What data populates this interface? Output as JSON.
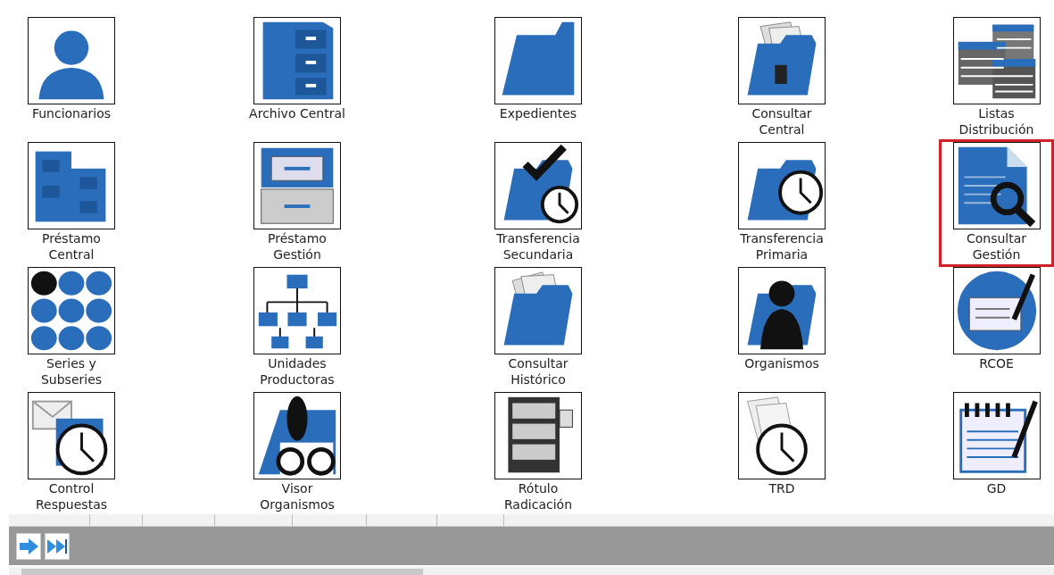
{
  "modules": [
    {
      "label": "Funcionarios",
      "kind": "person",
      "selected": false
    },
    {
      "label": "Archivo Central",
      "kind": "cabinet",
      "selected": false
    },
    {
      "label": "Expedientes",
      "kind": "folder",
      "selected": false
    },
    {
      "label": "Consultar Central",
      "kind": "folder-docs",
      "selected": false
    },
    {
      "label": "Listas Distribución",
      "kind": "lists",
      "selected": false
    },
    {
      "label": "Préstamo Central",
      "kind": "cabinets",
      "selected": false
    },
    {
      "label": "Préstamo Gestión",
      "kind": "drawers",
      "selected": false
    },
    {
      "label": "Transferencia Secundaria",
      "kind": "folder-check-clock",
      "selected": false
    },
    {
      "label": "Transferencia Primaria",
      "kind": "folder-clock",
      "selected": false
    },
    {
      "label": "Consultar Gestión",
      "kind": "doc-search",
      "selected": true
    },
    {
      "label": "Series y Subseries",
      "kind": "dots",
      "selected": false
    },
    {
      "label": "Unidades Productoras",
      "kind": "org-chart",
      "selected": false
    },
    {
      "label": "Consultar Histórico",
      "kind": "folder-papers",
      "selected": false
    },
    {
      "label": "Organismos",
      "kind": "folder-person",
      "selected": false
    },
    {
      "label": "RCOE",
      "kind": "form-pen",
      "selected": false
    },
    {
      "label": "Control Respuestas",
      "kind": "mail-clock",
      "selected": false
    },
    {
      "label": "Visor Organismos",
      "kind": "binoculars",
      "selected": false
    },
    {
      "label": "Rótulo Radicación",
      "kind": "server",
      "selected": false
    },
    {
      "label": "TRD",
      "kind": "papers-clock",
      "selected": false
    },
    {
      "label": "GD",
      "kind": "notebook-pen",
      "selected": false
    }
  ]
}
